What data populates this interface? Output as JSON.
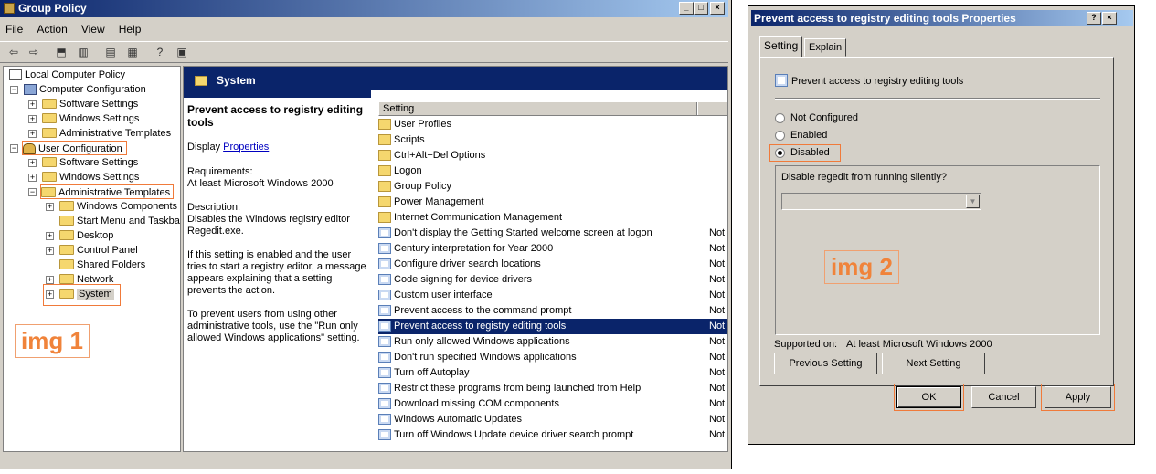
{
  "gp": {
    "title": "Group Policy",
    "menu": [
      "File",
      "Action",
      "View",
      "Help"
    ],
    "tree": {
      "root": "Local Computer Policy",
      "computer_config": "Computer Configuration",
      "cc_software": "Software Settings",
      "cc_windows": "Windows Settings",
      "cc_admin": "Administrative Templates",
      "user_config": "User Configuration",
      "uc_software": "Software Settings",
      "uc_windows": "Windows Settings",
      "uc_admin": "Administrative Templates",
      "windows_components": "Windows Components",
      "start_menu": "Start Menu and Taskba",
      "desktop": "Desktop",
      "control_panel": "Control Panel",
      "shared_folders": "Shared Folders",
      "network": "Network",
      "system": "System"
    },
    "annotation": "img 1",
    "pane_title": "System",
    "desc": {
      "heading": "Prevent access to registry editing tools",
      "display_label": "Display",
      "display_link": "Properties",
      "requirements_label": "Requirements:",
      "requirements": "At least Microsoft Windows 2000",
      "description_label": "Description:",
      "description": "Disables the Windows registry editor Regedit.exe.",
      "para2": "If this setting is enabled and the user tries to start a registry editor, a message appears explaining that a setting prevents the action.",
      "para3": "To prevent users from using other administrative tools, use the \"Run only allowed Windows applications\" setting."
    },
    "list_header": "Setting",
    "rows": [
      {
        "label": "User Profiles",
        "kind": "folder",
        "state": ""
      },
      {
        "label": "Scripts",
        "kind": "folder",
        "state": ""
      },
      {
        "label": "Ctrl+Alt+Del Options",
        "kind": "folder",
        "state": ""
      },
      {
        "label": "Logon",
        "kind": "folder",
        "state": ""
      },
      {
        "label": "Group Policy",
        "kind": "folder",
        "state": ""
      },
      {
        "label": "Power Management",
        "kind": "folder",
        "state": ""
      },
      {
        "label": "Internet Communication Management",
        "kind": "folder",
        "state": ""
      },
      {
        "label": "Don't display the Getting Started welcome screen at logon",
        "kind": "setting",
        "state": "Not"
      },
      {
        "label": "Century interpretation for Year 2000",
        "kind": "setting",
        "state": "Not"
      },
      {
        "label": "Configure driver search locations",
        "kind": "setting",
        "state": "Not"
      },
      {
        "label": "Code signing for device drivers",
        "kind": "setting",
        "state": "Not"
      },
      {
        "label": "Custom user interface",
        "kind": "setting",
        "state": "Not"
      },
      {
        "label": "Prevent access to the command prompt",
        "kind": "setting",
        "state": "Not"
      },
      {
        "label": "Prevent access to registry editing tools",
        "kind": "setting",
        "state": "Not",
        "selected": true
      },
      {
        "label": "Run only allowed Windows applications",
        "kind": "setting",
        "state": "Not"
      },
      {
        "label": "Don't run specified Windows applications",
        "kind": "setting",
        "state": "Not"
      },
      {
        "label": "Turn off Autoplay",
        "kind": "setting",
        "state": "Not"
      },
      {
        "label": "Restrict these programs from being launched from Help",
        "kind": "setting",
        "state": "Not"
      },
      {
        "label": "Download missing COM components",
        "kind": "setting",
        "state": "Not"
      },
      {
        "label": "Windows Automatic Updates",
        "kind": "setting",
        "state": "Not"
      },
      {
        "label": "Turn off Windows Update device driver search prompt",
        "kind": "setting",
        "state": "Not"
      }
    ]
  },
  "dlg": {
    "title": "Prevent access to registry editing tools Properties",
    "tab_setting": "Setting",
    "tab_explain": "Explain",
    "policy_name": "Prevent access to registry editing tools",
    "opt_not_configured": "Not Configured",
    "opt_enabled": "Enabled",
    "opt_disabled": "Disabled",
    "selected_option": "Disabled",
    "option_label": "Disable regedit from running silently?",
    "annotation": "img 2",
    "supported_label": "Supported on:",
    "supported_value": "At least Microsoft Windows 2000",
    "prev_button": "Previous Setting",
    "next_button": "Next Setting",
    "ok_button": "OK",
    "cancel_button": "Cancel",
    "apply_button": "Apply"
  },
  "colors": {
    "title_bar": "#0a246a",
    "highlight_box": "#f07a3a",
    "window_bg": "#d4d0c8"
  }
}
